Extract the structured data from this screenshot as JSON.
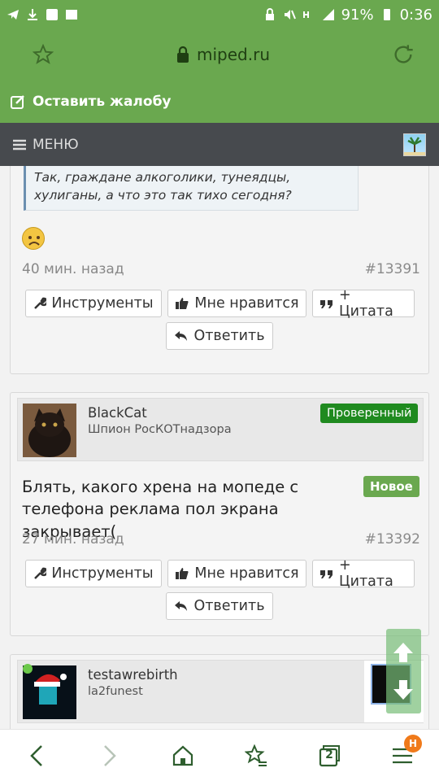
{
  "status": {
    "battery": "91%",
    "time": "0:36"
  },
  "browser": {
    "url": "miped.ru"
  },
  "header": {
    "complain_label": "Оставить жалобу",
    "menu_label": "МЕНЮ"
  },
  "posts": [
    {
      "quote": "Так, граждане алкоголики, тунеядцы, хулиганы, а что это так тихо сегодня?",
      "time": "40 мин. назад",
      "id": "#13391",
      "actions": {
        "tools": "Инструменты",
        "like": "Мне нравится",
        "quote": "+ Цитата",
        "reply": "Ответить"
      }
    },
    {
      "user": "BlackCat",
      "user_title": "Шпион РосКОТнадзора",
      "verified": "Проверенный",
      "new_badge": "Новое",
      "text": "Блять, какого хрена на мопеде с телефона реклама пол экрана закрывает(",
      "time": "27 мин. назад",
      "id": "#13392",
      "actions": {
        "tools": "Инструменты",
        "like": "Мне нравится",
        "quote": "+ Цитата",
        "reply": "Ответить"
      }
    },
    {
      "user": "testawrebirth",
      "user_title": "la2funest"
    }
  ],
  "bottom_nav": {
    "tabs_count": "2",
    "menu_badge": "H"
  },
  "colors": {
    "brand_green": "#6aa84f",
    "menu_dark": "#474a4e",
    "verified": "#1f8a1f",
    "new": "#6aa84f"
  }
}
